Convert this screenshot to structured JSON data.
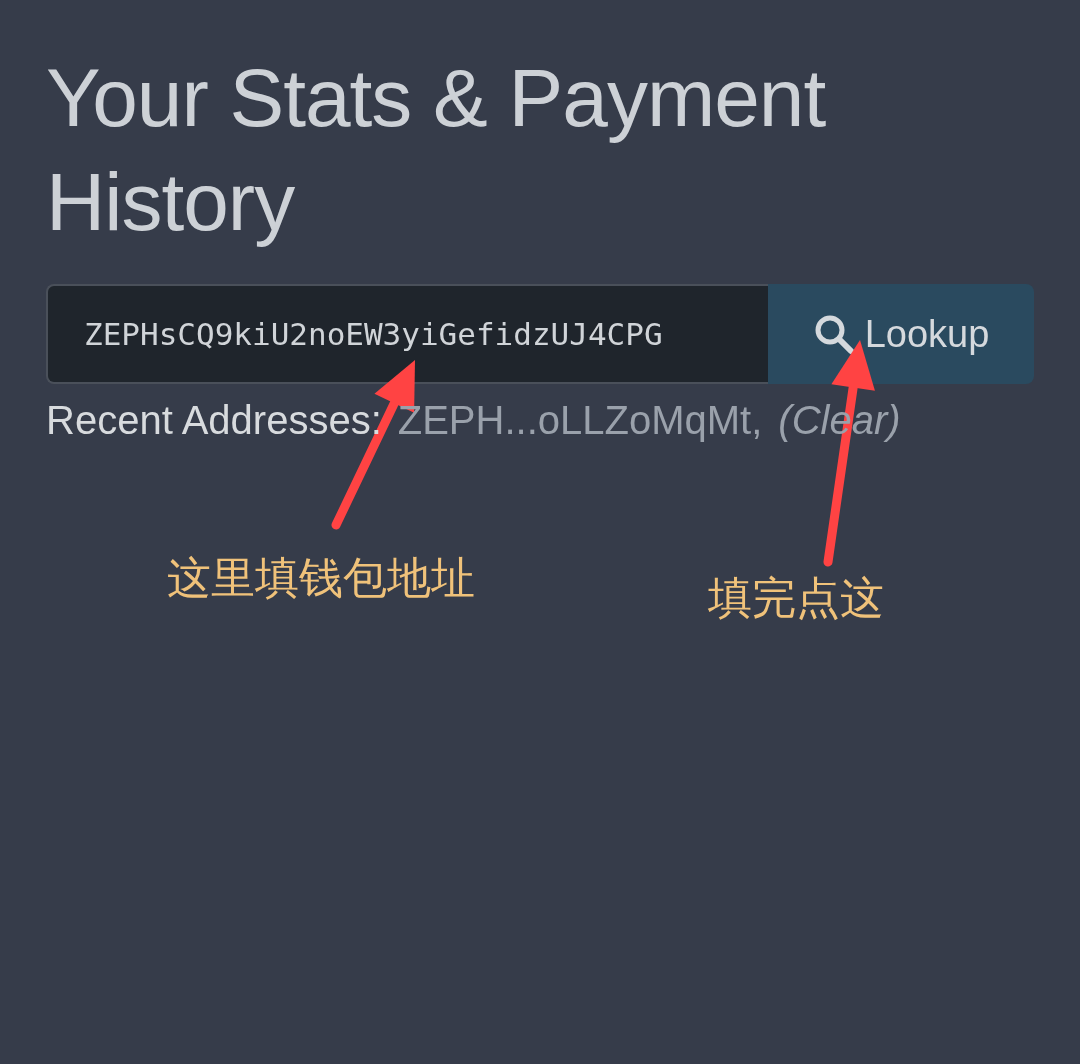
{
  "heading": "Your Stats & Payment History",
  "lookup": {
    "value": "ZEPHsCQ9kiU2noEW3yiGefidzUJ4CPG",
    "button": "Lookup"
  },
  "recent": {
    "label": "Recent Addresses:",
    "addresses": [
      "ZEPH...oLLZoMqMt,"
    ],
    "clear": "(Clear)"
  },
  "annotations": [
    {
      "text": "这里填钱包地址"
    },
    {
      "text": "填完点这"
    }
  ]
}
